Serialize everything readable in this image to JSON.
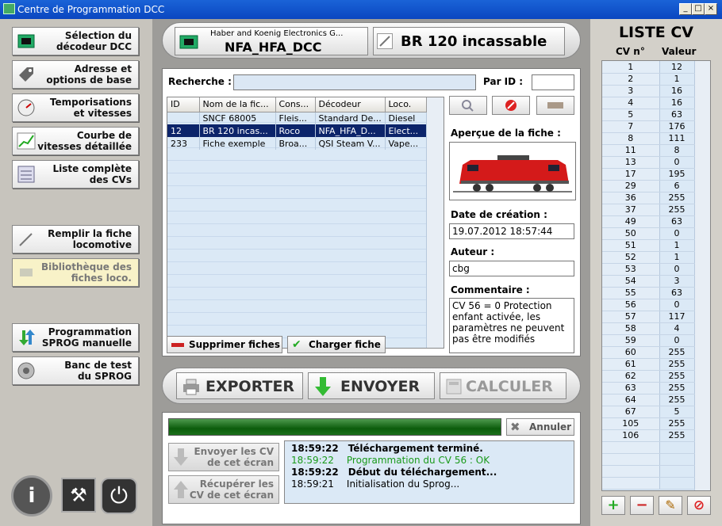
{
  "window": {
    "title": "Centre de Programmation DCC",
    "buttons": [
      "_",
      "□",
      "×"
    ]
  },
  "sidebar": {
    "items": [
      {
        "label": "Sélection du\ndécodeur DCC",
        "icon": "chip-icon"
      },
      {
        "label": "Adresse et\noptions de base",
        "icon": "tag-icon"
      },
      {
        "label": "Temporisations\net vitesses",
        "icon": "gauge-icon"
      },
      {
        "label": "Courbe de\nvitesses détaillée",
        "icon": "curve-icon"
      },
      {
        "label": "Liste complète\ndes CVs",
        "icon": "list-icon"
      },
      {
        "label": "Remplir la fiche\nlocomotive",
        "icon": "pencil-icon"
      },
      {
        "label": "Bibliothèque des\nfiches loco.",
        "icon": "library-icon"
      },
      {
        "label": "Programmation\nSPROG manuelle",
        "icon": "arrows-icon"
      },
      {
        "label": "Banc de test\ndu SPROG",
        "icon": "speaker-icon"
      }
    ],
    "bottom": [
      "i",
      "⚒",
      "⏻"
    ]
  },
  "header": {
    "decoder_maker": "Haber and Koenig Electronics G...",
    "decoder_name": "NFA_HFA_DCC",
    "loco_name": "BR 120 incassable"
  },
  "search": {
    "label": "Recherche :",
    "value": "",
    "id_label": "Par ID :",
    "id_value": ""
  },
  "table": {
    "columns": [
      "ID",
      "Nom de la fic...",
      "Cons...",
      "Décodeur",
      "Loco."
    ],
    "rows": [
      [
        "",
        "SNCF 68005",
        "Fleis...",
        "Standard De...",
        "Diesel"
      ],
      [
        "12",
        "BR 120 incas...",
        "Roco",
        "NFA_HFA_D...",
        "Elect..."
      ],
      [
        "233",
        "Fiche exemple",
        "Broa...",
        "QSI Steam V...",
        "Vape..."
      ]
    ],
    "selected_row": 1
  },
  "actions": {
    "delete": "Supprimer fiches",
    "load": "Charger fiche"
  },
  "preview": {
    "label": "Aperçue de la fiche :",
    "date_label": "Date de création :",
    "date_value": "19.07.2012 18:57:44",
    "author_label": "Auteur :",
    "author_value": "cbg",
    "comment_label": "Commentaire :",
    "comment_value": "CV 56 = 0 Protection enfant activée, les paramètres ne peuvent pas être modifiés"
  },
  "bigbar": {
    "export": "EXPORTER",
    "send": "ENVOYER",
    "calc": "CALCULER"
  },
  "progress": {
    "value": 1.0,
    "cancel": "Annuler"
  },
  "transfer": {
    "send_cv": "Envoyer les CV\nde cet écran",
    "get_cv": "Récupérer les\nCV de cet écran"
  },
  "log": [
    {
      "time": "18:59:22",
      "text": "Téléchargement terminé.",
      "style": "bold"
    },
    {
      "time": "18:59:22",
      "text": "Programmation du CV 56 : OK",
      "style": "green"
    },
    {
      "time": "18:59:22",
      "text": "Début du téléchargement...",
      "style": "bold"
    },
    {
      "time": "18:59:21",
      "text": "Initialisation du Sprog...",
      "style": "normal"
    }
  ],
  "cvlist": {
    "title": "LISTE CV",
    "col_cv": "CV n°",
    "col_val": "Valeur",
    "rows": [
      [
        "1",
        "12"
      ],
      [
        "2",
        "1"
      ],
      [
        "3",
        "16"
      ],
      [
        "4",
        "16"
      ],
      [
        "5",
        "63"
      ],
      [
        "7",
        "176"
      ],
      [
        "8",
        "111"
      ],
      [
        "11",
        "8"
      ],
      [
        "13",
        "0"
      ],
      [
        "17",
        "195"
      ],
      [
        "29",
        "6"
      ],
      [
        "36",
        "255"
      ],
      [
        "37",
        "255"
      ],
      [
        "49",
        "63"
      ],
      [
        "50",
        "0"
      ],
      [
        "51",
        "1"
      ],
      [
        "52",
        "1"
      ],
      [
        "53",
        "0"
      ],
      [
        "54",
        "3"
      ],
      [
        "55",
        "63"
      ],
      [
        "56",
        "0"
      ],
      [
        "57",
        "117"
      ],
      [
        "58",
        "4"
      ],
      [
        "59",
        "0"
      ],
      [
        "60",
        "255"
      ],
      [
        "61",
        "255"
      ],
      [
        "62",
        "255"
      ],
      [
        "63",
        "255"
      ],
      [
        "64",
        "255"
      ],
      [
        "67",
        "5"
      ],
      [
        "105",
        "255"
      ],
      [
        "106",
        "255"
      ]
    ],
    "buttons": [
      "+",
      "−",
      "✎",
      "⊘"
    ]
  }
}
